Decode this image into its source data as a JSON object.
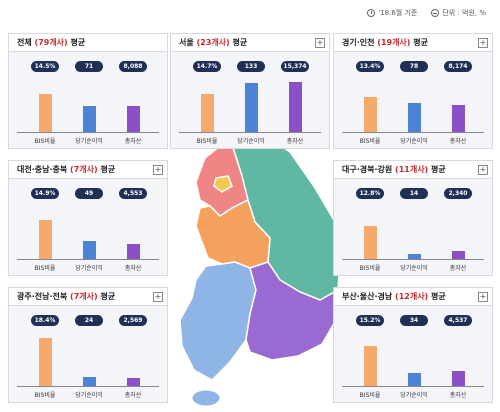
{
  "header": {
    "date_note": "'18.6월 기준",
    "unit_note": "단위 : 억원, %"
  },
  "icons": {
    "date": "clock-icon",
    "unit": "unit-icon"
  },
  "colors": {
    "bis": "#f4a15d",
    "net": "#3e77cf",
    "asset": "#8b4fc8",
    "pill": "#1f2f55",
    "highlight": "#c8292f"
  },
  "labels": {
    "bis": "BIS비율",
    "net": "당기순이익",
    "asset": "총자산"
  },
  "panels": [
    {
      "region": "전체",
      "count": "(79개사)",
      "suffix": "평균",
      "has_plus": false,
      "bis": "14.5%",
      "net": "71",
      "asset": "8,088",
      "bis_pct": 14.5,
      "net_val": 71,
      "asset_val": 8088
    },
    {
      "region": "서울",
      "count": "(23개사)",
      "suffix": "평균",
      "has_plus": true,
      "bis": "14.7%",
      "net": "133",
      "asset": "15,374",
      "bis_pct": 14.7,
      "net_val": 133,
      "asset_val": 15374
    },
    {
      "region": "경기·인천",
      "count": "(19개사)",
      "suffix": "평균",
      "has_plus": true,
      "bis": "13.4%",
      "net": "78",
      "asset": "8,174",
      "bis_pct": 13.4,
      "net_val": 78,
      "asset_val": 8174
    },
    {
      "region": "대전·충남·충북",
      "count": "(7개사)",
      "suffix": "평균",
      "has_plus": true,
      "bis": "14.9%",
      "net": "49",
      "asset": "4,553",
      "bis_pct": 14.9,
      "net_val": 49,
      "asset_val": 4553
    },
    {
      "region": "대구·경북·강원",
      "count": "(11개사)",
      "suffix": "평균",
      "has_plus": true,
      "bis": "12.8%",
      "net": "14",
      "asset": "2,340",
      "bis_pct": 12.8,
      "net_val": 14,
      "asset_val": 2340
    },
    {
      "region": "광주·전남·전북",
      "count": "(7개사)",
      "suffix": "평균",
      "has_plus": true,
      "bis": "18.4%",
      "net": "24",
      "asset": "2,569",
      "bis_pct": 18.4,
      "net_val": 24,
      "asset_val": 2569
    },
    {
      "region": "부산·울산·경남",
      "count": "(12개사)",
      "suffix": "평균",
      "has_plus": true,
      "bis": "15.2%",
      "net": "34",
      "asset": "4,537",
      "bis_pct": 15.2,
      "net_val": 34,
      "asset_val": 4537
    }
  ]
}
